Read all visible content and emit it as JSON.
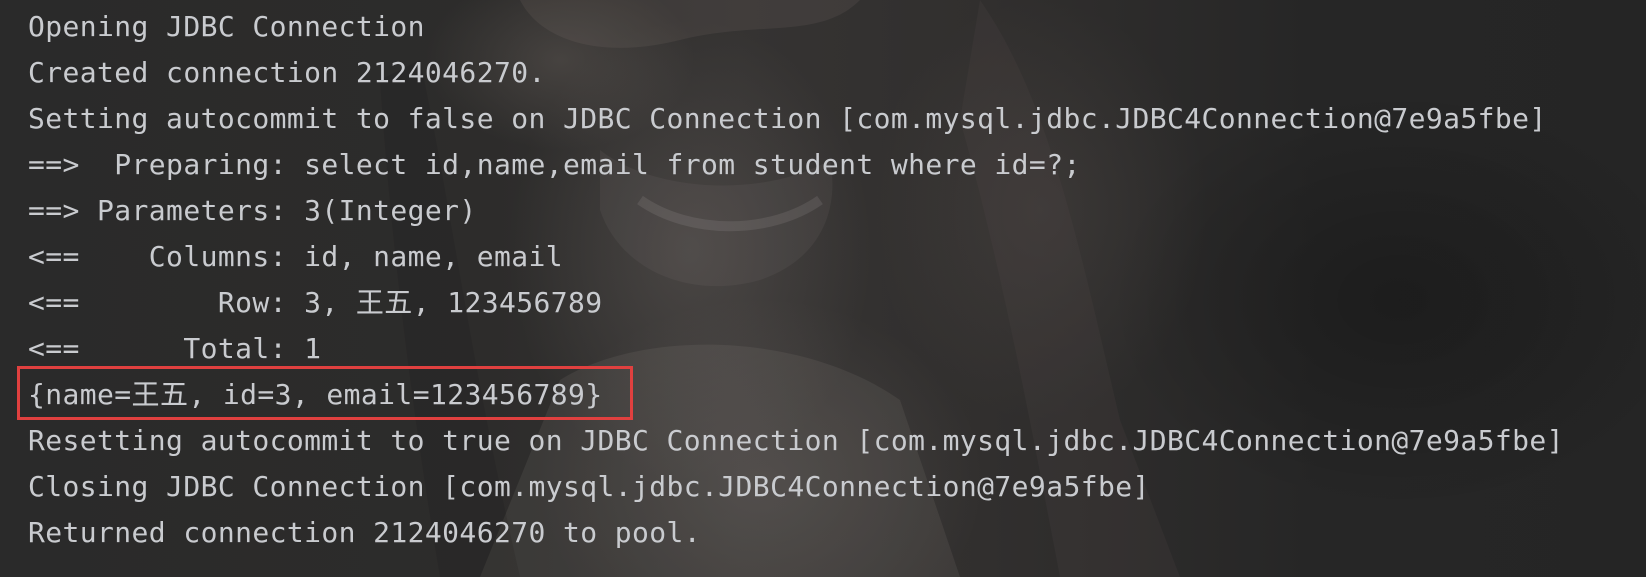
{
  "console": {
    "lines": [
      "Opening JDBC Connection",
      "Created connection 2124046270.",
      "Setting autocommit to false on JDBC Connection [com.mysql.jdbc.JDBC4Connection@7e9a5fbe]",
      "==>  Preparing: select id,name,email from student where id=?;",
      "==> Parameters: 3(Integer)",
      "<==    Columns: id, name, email",
      "<==        Row: 3, 王五, 123456789",
      "<==      Total: 1",
      "{name=王五, id=3, email=123456789}",
      "Resetting autocommit to true on JDBC Connection [com.mysql.jdbc.JDBC4Connection@7e9a5fbe]",
      "Closing JDBC Connection [com.mysql.jdbc.JDBC4Connection@7e9a5fbe]",
      "Returned connection 2124046270 to pool."
    ],
    "highlighted_line_index": 8,
    "text_color": "#c9cbcf",
    "highlight_color": "#e0403f",
    "background_color": "#2b2b2b"
  }
}
